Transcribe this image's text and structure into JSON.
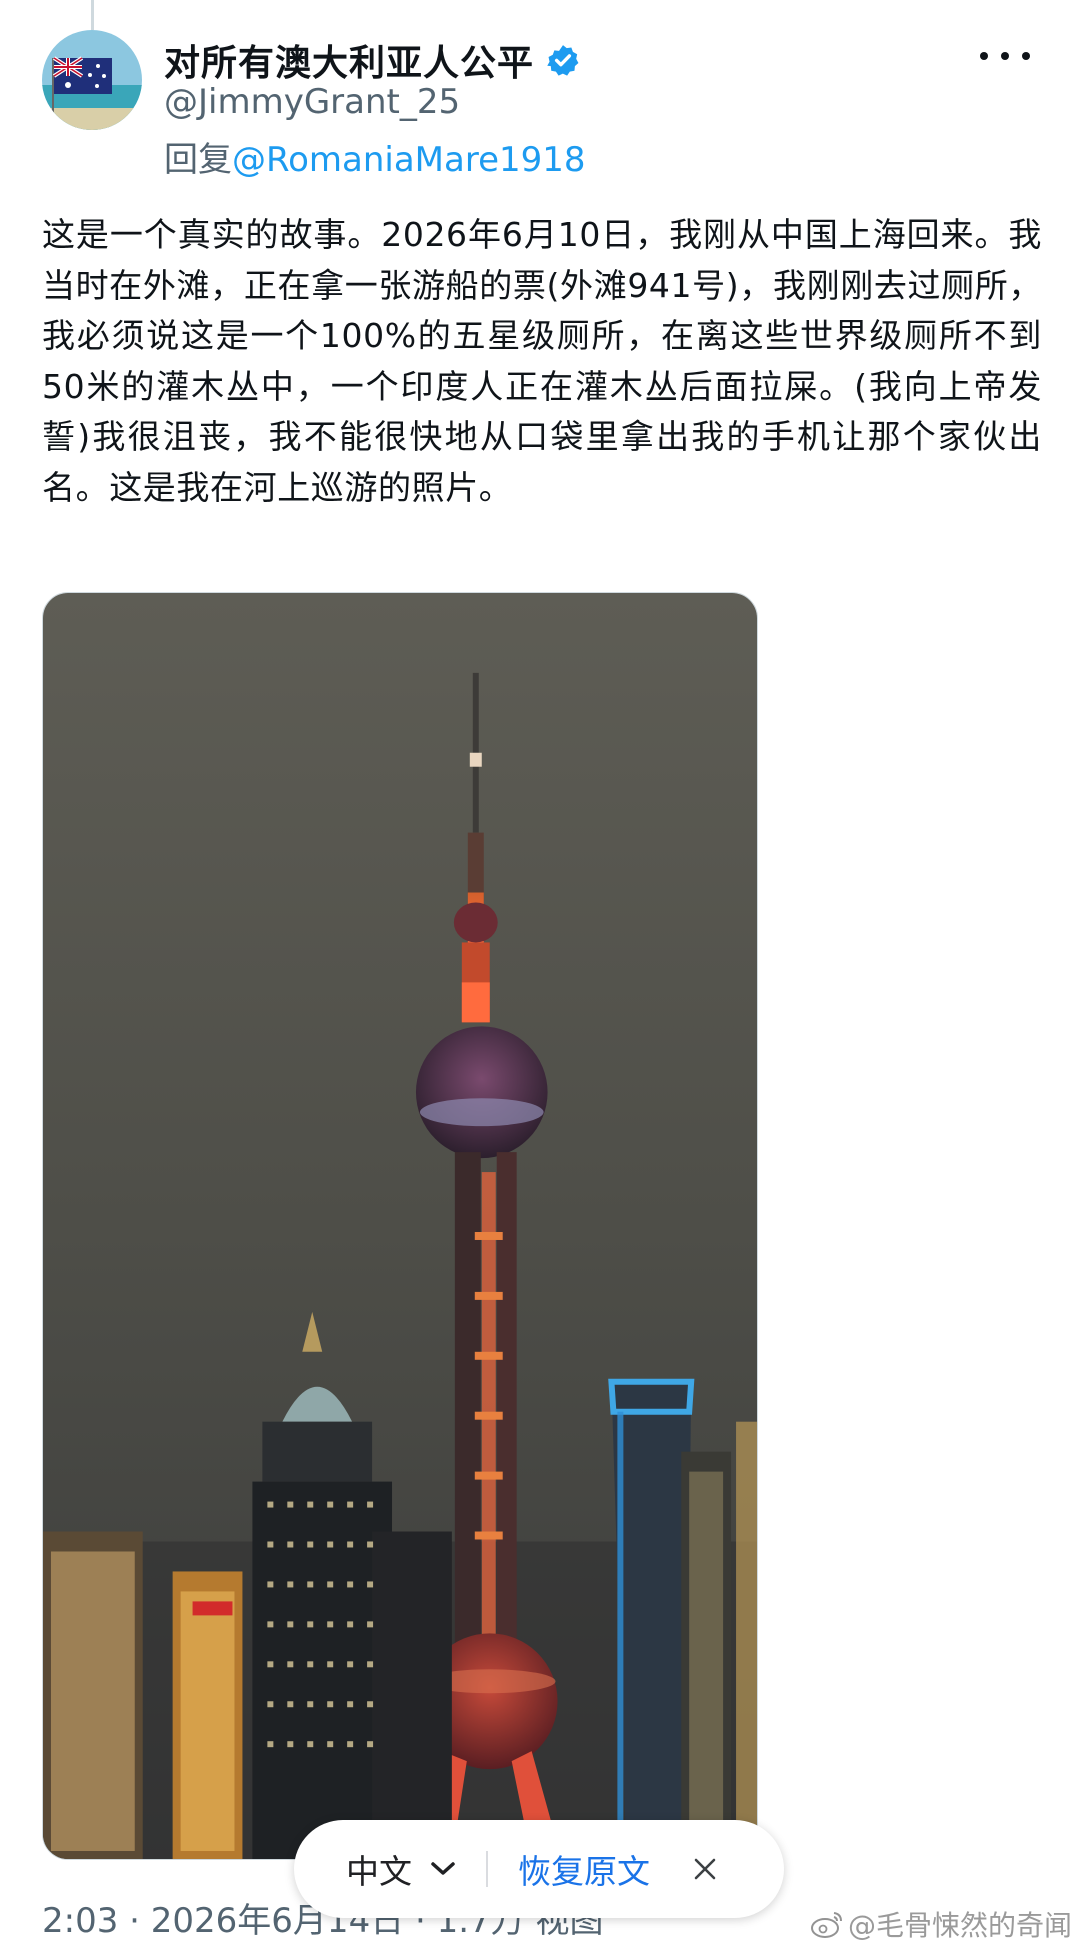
{
  "tweet": {
    "display_name": "对所有澳大利亚人公平",
    "handle": "@JimmyGrant_25",
    "reply_prefix": "回复",
    "reply_mention": "@RomaniaMare1918",
    "text": "这是一个真实的故事。2026年6月10日，我刚从中国上海回来。我当时在外滩，正在拿一张游船的票(外滩941号)，我刚刚去过厕所，我必须说这是一个100%的五星级厕所，在离这些世界级厕所不到50米的灌木丛中，一个印度人正在灌木丛后面拉屎。(我向上帝发誓)我很沮丧，我不能很快地从口袋里拿出我的手机让那个家伙出名。这是我在河上巡游的照片。",
    "meta": "2:03 · 2026年6月14日 · 1.7万 视图"
  },
  "translate_bar": {
    "language": "中文",
    "restore_label": "恢复原文"
  },
  "watermark": "@毛骨悚然的奇闻",
  "colors": {
    "link": "#1d9bf0",
    "secondary_text": "#536471",
    "translate_link": "#1a73e8"
  },
  "icons": {
    "verified": "verified-badge-icon",
    "more": "more-dots-icon",
    "chevron": "chevron-down-icon",
    "close": "close-icon",
    "watermark": "weibo-logo-icon"
  }
}
